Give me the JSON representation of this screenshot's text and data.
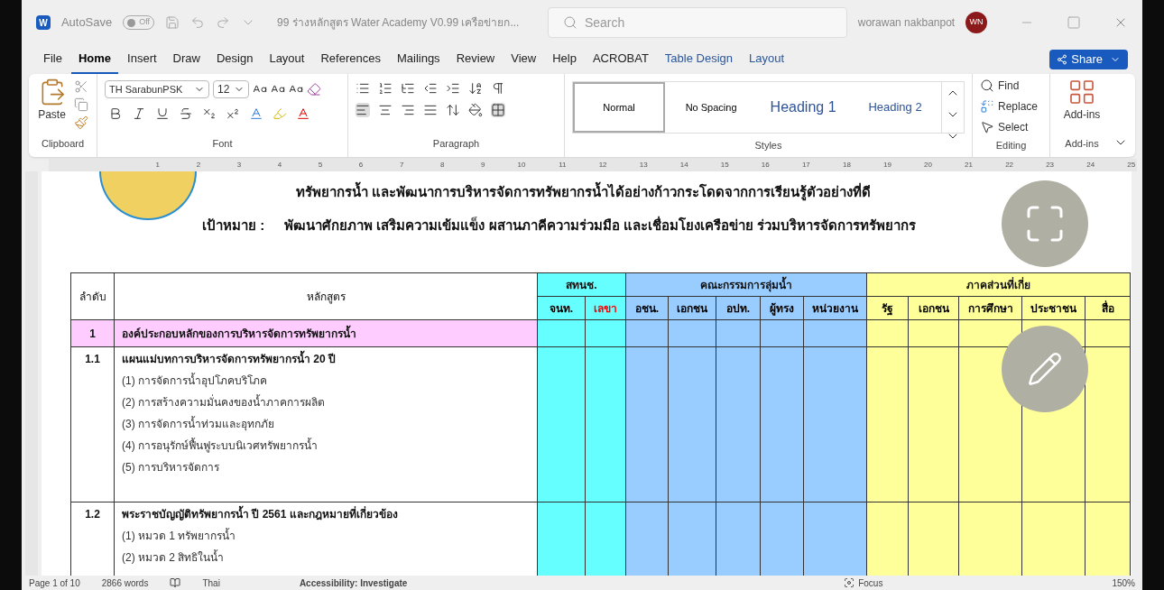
{
  "window": {
    "app": "W",
    "autosave": {
      "label": "AutoSave",
      "on": false,
      "state": "Off"
    },
    "title": "99 ร่างหลักสูตร Water Academy V0.99 เครือข่ายก...",
    "search": {
      "placeholder": "Search"
    },
    "user": "worawan nakbanpot",
    "initials": "WN"
  },
  "menu_tabs": [
    {
      "label": "File",
      "selected": false,
      "kind": "normal"
    },
    {
      "label": "Home",
      "selected": true,
      "kind": "normal"
    },
    {
      "label": "Insert",
      "selected": false,
      "kind": "normal"
    },
    {
      "label": "Draw",
      "selected": false,
      "kind": "normal"
    },
    {
      "label": "Design",
      "selected": false,
      "kind": "normal"
    },
    {
      "label": "Layout",
      "selected": false,
      "kind": "normal"
    },
    {
      "label": "References",
      "selected": false,
      "kind": "normal"
    },
    {
      "label": "Mailings",
      "selected": false,
      "kind": "normal"
    },
    {
      "label": "Review",
      "selected": false,
      "kind": "normal"
    },
    {
      "label": "View",
      "selected": false,
      "kind": "normal"
    },
    {
      "label": "Help",
      "selected": false,
      "kind": "normal"
    },
    {
      "label": "ACROBAT",
      "selected": false,
      "kind": "normal"
    },
    {
      "label": "Table Design",
      "selected": false,
      "kind": "contextual"
    },
    {
      "label": "Layout",
      "selected": false,
      "kind": "contextual"
    }
  ],
  "share": "Share",
  "ribbon": {
    "clipboard": {
      "paste": "Paste",
      "label": "Clipboard"
    },
    "font": {
      "name": "TH SarabunPSK",
      "size": "12",
      "label": "Font"
    },
    "paragraph": {
      "label": "Paragraph"
    },
    "styles": {
      "items": [
        {
          "label": "Normal",
          "selected": true,
          "kind": "normal"
        },
        {
          "label": "No Spacing",
          "selected": false,
          "kind": "normal"
        },
        {
          "label": "Heading 1",
          "selected": false,
          "kind": "heading1"
        },
        {
          "label": "Heading 2",
          "selected": false,
          "kind": "heading2"
        }
      ],
      "label": "Styles"
    },
    "editing": {
      "find": "Find",
      "replace": "Replace",
      "select": "Select",
      "label": "Editing"
    },
    "addins": {
      "button": "Add-ins",
      "label": "Add-ins"
    }
  },
  "ruler": [
    "1",
    "2",
    "3",
    "4",
    "5",
    "6",
    "7",
    "8",
    "9",
    "10",
    "11",
    "12",
    "13",
    "14",
    "15",
    "16",
    "17",
    "18",
    "19",
    "20",
    "21",
    "22",
    "23",
    "24",
    "25"
  ],
  "document": {
    "heading": "ทรัพยากรน้ำ และพัฒนาการบริหารจัดการทรัพยากรน้ำได้อย่างก้าวกระโดดจากการเรียนรู้ตัวอย่างที่ดี",
    "goal_label": "เป้าหมาย :",
    "goal": "พัฒนาศักยภาพ เสริมความเข้มแข็ง ผสานภาคีความร่วมมือ และเชื่อมโยงเครือข่าย ร่วมบริหารจัดการทรัพยากร",
    "table": {
      "col_number": "ลำดับ",
      "col_course": "หลักสูตร",
      "groups": [
        {
          "label": "สทนช.",
          "color": "#66ffff",
          "columns": [
            {
              "label": "จนท.",
              "color": "#000000"
            },
            {
              "label": "เลขา",
              "color": "#ff0000"
            }
          ]
        },
        {
          "label": "คณะกรรมการลุ่มน้ำ",
          "color": "#99ccff",
          "columns": [
            {
              "label": "อชน.",
              "color": "#000000"
            },
            {
              "label": "เอกชน",
              "color": "#000000"
            },
            {
              "label": "อปท.",
              "color": "#000000"
            },
            {
              "label": "ผู้ทรง",
              "color": "#000000"
            },
            {
              "label": "หน่วยงาน",
              "color": "#000000"
            }
          ]
        },
        {
          "label": "ภาคส่วนที่เกี่ย",
          "color": "#ffff99",
          "columns": [
            {
              "label": "รัฐ",
              "color": "#000000"
            },
            {
              "label": "เอกชน",
              "color": "#000000"
            },
            {
              "label": "การศึกษา",
              "color": "#000000"
            },
            {
              "label": "ประชาชน",
              "color": "#000000"
            },
            {
              "label": "สื่อ",
              "color": "#000000"
            }
          ]
        }
      ],
      "rows": [
        {
          "kind": "section",
          "number": "1",
          "title": "องค์ประกอบหลักของการบริหารจัดการทรัพยากรน้ำ",
          "items": []
        },
        {
          "kind": "topic",
          "number": "1.1",
          "title": "แผนแม่บทการบริหารจัดการทรัพยากรน้ำ 20 ปี",
          "items": [
            "(1) การจัดการน้ำอุปโภคบริโภค",
            "(2) การสร้างความมั่นคงของน้ำภาคการผลิต",
            "(3) การจัดการน้ำท่วมและอุทกภัย",
            "(4) การอนุรักษ์ฟื้นฟูระบบนิเวศทรัพยากรน้ำ",
            "(5) การบริหารจัดการ"
          ]
        },
        {
          "kind": "topic",
          "number": "1.2",
          "title": "พระราชบัญญัติทรัพยากรน้ำ ปี 2561 และกฎหมายที่เกี่ยวข้อง",
          "items": [
            "(1) หมวด 1 ทรัพยากรน้ำ",
            "(2) หมวด 2 สิทธิในน้ำ"
          ]
        }
      ]
    }
  },
  "status_bar": {
    "page": "Page 1 of 10",
    "words": "2866 words",
    "language": "Thai",
    "accessibility": "Accessibility: Investigate",
    "focus": "Focus",
    "zoom": "150%"
  }
}
